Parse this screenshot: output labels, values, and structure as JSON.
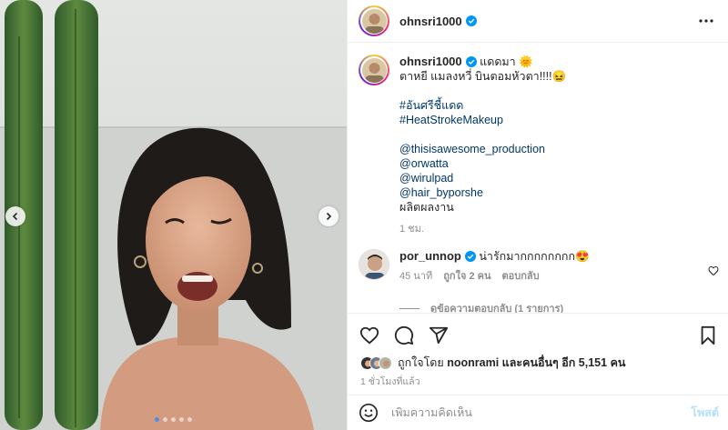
{
  "post": {
    "username": "ohnsri1000",
    "verified": true,
    "more_icon": "more-horizontal-icon"
  },
  "caption": {
    "username": "ohnsri1000",
    "line1_suffix": "แดดมา 🌞",
    "line2": "ตาหยี แมลงหวี่ บินตอมหัวตา!!!!😖",
    "hashtags": [
      "#อันศรีชี้แดด",
      "#HeatStrokeMakeup"
    ],
    "mentions": [
      "@thisisawesome_production",
      "@orwatta",
      "@wirulpad",
      "@hair_byporshe"
    ],
    "closing": "ผลิตผลงาน",
    "time": "1 ชม."
  },
  "comment": {
    "username": "por_unnop",
    "text": "น่ารักมากกกกกกกก😍",
    "time": "45 นาที",
    "likes": "ถูกใจ 2 คน",
    "reply": "ตอบกลับ",
    "view_replies": "ดูข้อความตอบกลับ (1 รายการ)"
  },
  "likes": {
    "prefix": "ถูกใจโดย",
    "user": "noonrami",
    "middle": "และคนอื่นๆ อีก",
    "count": "5,151",
    "suffix": "คน"
  },
  "posted_ago": "1 ชั่วโมงที่แล้ว",
  "add_comment": {
    "placeholder": "เพิ่มความคิดเห็น",
    "post_label": "โพสต์"
  },
  "carousel": {
    "slides": 5,
    "current": 1
  },
  "colors": {
    "link": "#00376b",
    "verified": "#0095f6",
    "muted": "#8e8e8e",
    "post_disabled": "#b2dffc"
  }
}
